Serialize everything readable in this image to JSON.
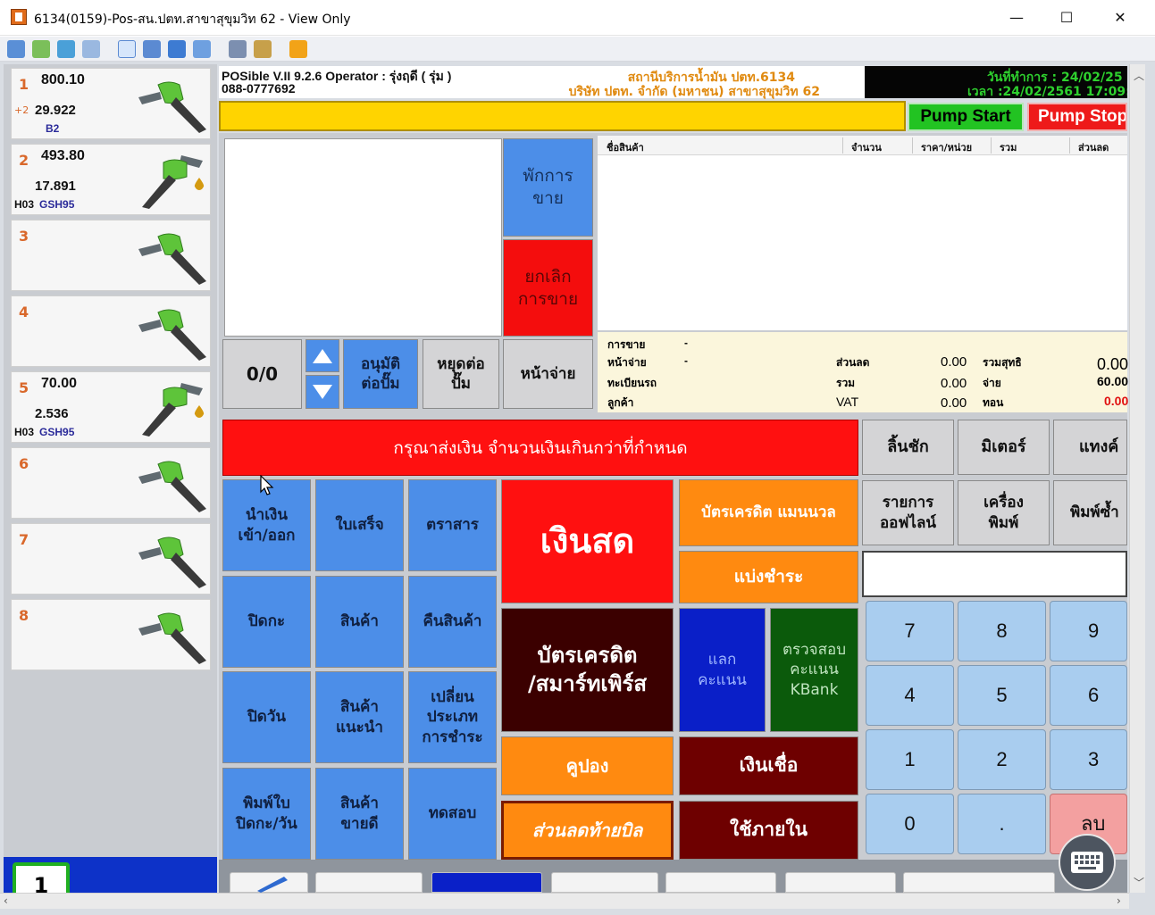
{
  "window": {
    "title": "6134(0159)-Pos-สน.ปตท.สาขาสุขุมวิท 62 - View Only",
    "minimize": "—",
    "maximize": "☐",
    "close": "✕"
  },
  "toolbar": {
    "icons": [
      "monitor-icon",
      "transfer-icon",
      "phone-icon",
      "chat-icon",
      "window-icon",
      "fit-icon",
      "fullscreen-icon",
      "scale-icon",
      "multi-window-icon",
      "tools-icon",
      "close-session-icon"
    ]
  },
  "pumps": [
    {
      "number": "1",
      "amount": "800.10",
      "volume": "29.922",
      "tag": "+2",
      "code": "",
      "grade": "B2",
      "state": "active"
    },
    {
      "number": "2",
      "amount": "493.80",
      "volume": "17.891",
      "tag": "",
      "code": "H03",
      "grade": "GSH95",
      "state": "paid"
    },
    {
      "number": "3",
      "amount": "",
      "volume": "",
      "tag": "",
      "code": "",
      "grade": "",
      "state": "idle"
    },
    {
      "number": "4",
      "amount": "",
      "volume": "",
      "tag": "",
      "code": "",
      "grade": "",
      "state": "idle"
    },
    {
      "number": "5",
      "amount": "70.00",
      "volume": "2.536",
      "tag": "",
      "code": "H03",
      "grade": "GSH95",
      "state": "paid"
    },
    {
      "number": "6",
      "amount": "",
      "volume": "",
      "tag": "",
      "code": "",
      "grade": "",
      "state": "idle"
    },
    {
      "number": "7",
      "amount": "",
      "volume": "",
      "tag": "",
      "code": "",
      "grade": "",
      "state": "idle"
    },
    {
      "number": "8",
      "amount": "",
      "volume": "",
      "tag": "",
      "code": "",
      "grade": "",
      "state": "idle"
    }
  ],
  "pump_bottom": {
    "label": "1"
  },
  "header": {
    "version": "POSible V.II 9.2.6 Operator : รุ่งฤดี ( รุ่ม )",
    "phone": "088-0777692",
    "station": "สถานีบริการน้ำมัน ปตท.6134",
    "company": "บริษัท ปตท. จำกัด (มหาชน) สาขาสุขุมวิท 62",
    "work_date": "วันที่ทำการ : 24/02/25",
    "clock": "เวลา :24/02/2561 17:09:"
  },
  "pump_controls": {
    "start": "Pump Start",
    "stop": "Pump Stop"
  },
  "left_controls": {
    "pause_sale": [
      "พักการ",
      "ขาย"
    ],
    "cancel_sale": [
      "ยกเลิก",
      "การขาย"
    ],
    "counter": "0/0",
    "approve_pump": [
      "อนุมัติ",
      "ต่อปั๊ม"
    ],
    "stop_pump": [
      "หยุดต่อ",
      "ปั๊ม"
    ],
    "pay_screen": "หน้าจ่าย"
  },
  "items_table": {
    "columns": [
      "ชื่อสินค้า",
      "จำนวน",
      "ราคา/หน่วย",
      "รวม",
      "ส่วนลด"
    ],
    "rows": []
  },
  "summary": {
    "sale_label": "การขาย",
    "sale_value": "-",
    "pay_label": "หน้าจ่าย",
    "pay_value": "-",
    "plate_label": "ทะเบียนรถ",
    "customer_label": "ลูกค้า",
    "discount_label": "ส่วนลด",
    "discount_value": "0.00",
    "total_label": "รวม",
    "total_value": "0.00",
    "vat_label": "VAT",
    "vat_value": "0.00",
    "net_label": "รวมสุทธิ",
    "net_value": "0.00",
    "paid_label": "จ่าย",
    "paid_value": "60.00",
    "change_label": "ทอน",
    "change_value": "0.00"
  },
  "warning": "กรุณาส่งเงิน จำนวนเงินเกินกว่าที่กำหนด",
  "function_buttons": {
    "cash_in_out": [
      "นำเงิน",
      "เข้า/ออก"
    ],
    "receipt": "ใบเสร็จ",
    "stamp": "ตราสาร",
    "close_shift": "ปิดกะ",
    "products": "สินค้า",
    "return_product": "คืนสินค้า",
    "close_day": "ปิดวัน",
    "recommended": [
      "สินค้า",
      "แนะนำ"
    ],
    "change_payment": [
      "เปลี่ยน",
      "ประเภท",
      "การชำระ"
    ],
    "print_shift": [
      "พิมพ์ใบ",
      "ปิดกะ/วัน"
    ],
    "bestseller": [
      "สินค้า",
      "ขายดี"
    ],
    "test": "ทดสอบ"
  },
  "payment_buttons": {
    "cash": "เงินสด",
    "credit_manual": "บัตรเครดิต แมนนวล",
    "installment": "แบ่งชำระ",
    "credit_smart": [
      "บัตรเครดิต",
      "/สมาร์ทเพิร์ส"
    ],
    "redeem_points": [
      "แลก",
      "คะแนน"
    ],
    "check_points": [
      "ตรวจสอบ",
      "คะแนน",
      "KBank"
    ],
    "coupon": "คูปอง",
    "on_credit": "เงินเชื่อ",
    "bill_discount": "ส่วนลดท้ายบิล",
    "internal_use": "ใช้ภายใน"
  },
  "right_buttons": {
    "drawer": "ลิ้นชัก",
    "meter": "มิเตอร์",
    "tank": "แทงค์",
    "offline_list": [
      "รายการ",
      "ออฟไลน์"
    ],
    "printer": [
      "เครื่อง",
      "พิมพ์"
    ],
    "reprint": "พิมพ์ซ้ำ"
  },
  "keypad": {
    "keys": [
      "7",
      "8",
      "9",
      "4",
      "5",
      "6",
      "1",
      "2",
      "3",
      "0",
      ".",
      "ลบ"
    ]
  },
  "bottom_strip": {
    "labels": []
  }
}
